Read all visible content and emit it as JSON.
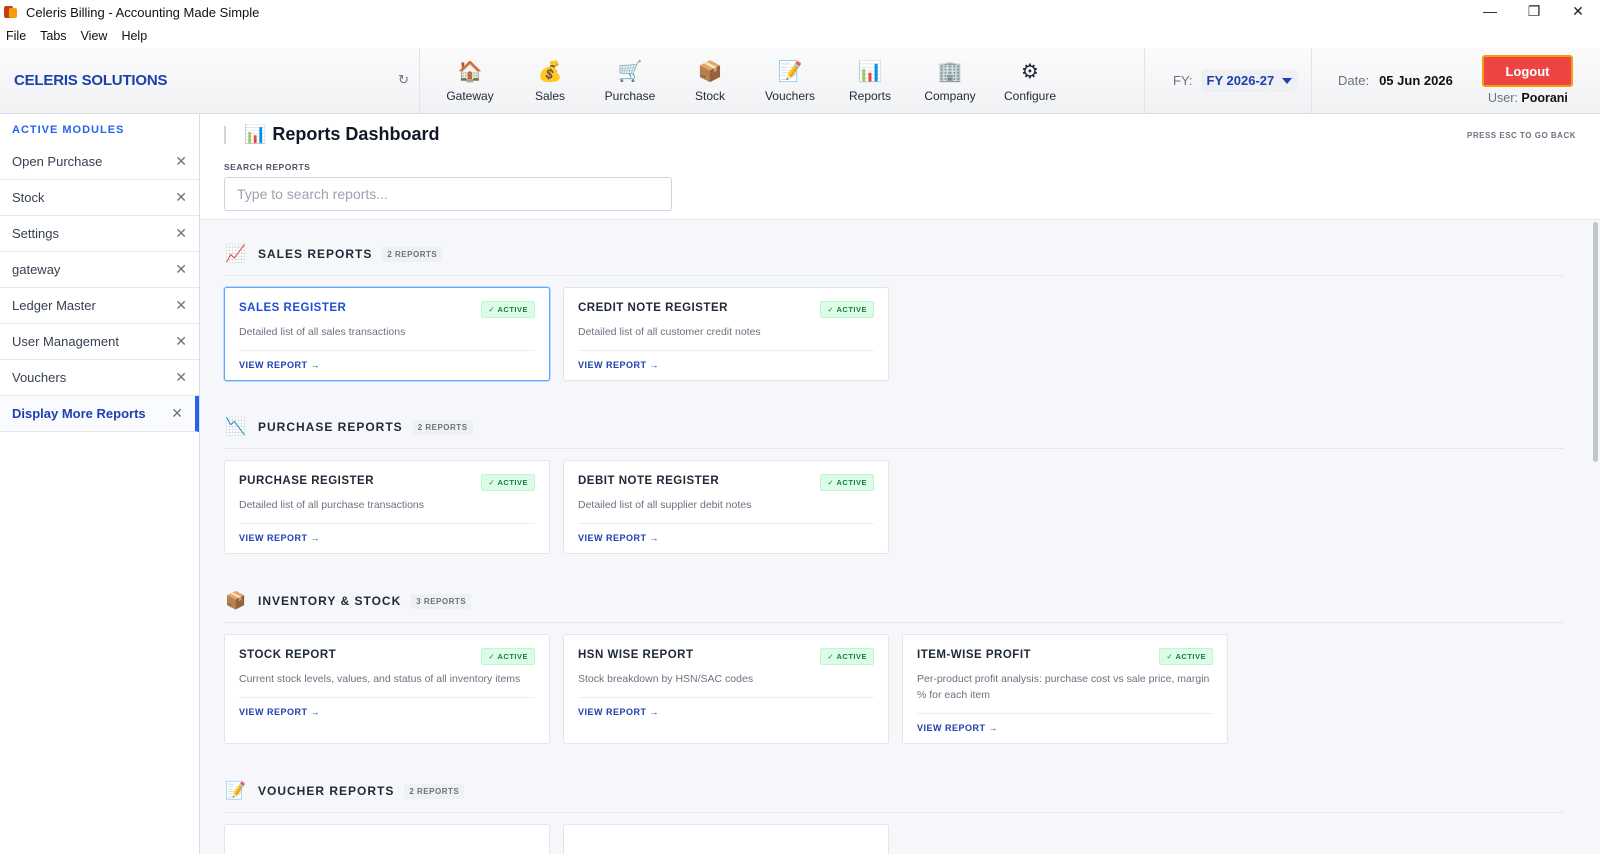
{
  "window": {
    "title": "Celeris Billing - Accounting Made Simple",
    "controls": [
      "—",
      "❐",
      "✕"
    ]
  },
  "menu": [
    "File",
    "Tabs",
    "View",
    "Help"
  ],
  "header": {
    "brand": "CELERIS SOLUTIONS",
    "refresh_icon": "↻",
    "nav": [
      {
        "label": "Gateway",
        "icon": "🏠"
      },
      {
        "label": "Sales",
        "icon": "💰"
      },
      {
        "label": "Purchase",
        "icon": "🛒"
      },
      {
        "label": "Stock",
        "icon": "📦"
      },
      {
        "label": "Vouchers",
        "icon": "📝"
      },
      {
        "label": "Reports",
        "icon": "📊"
      },
      {
        "label": "Company",
        "icon": "🏢"
      },
      {
        "label": "Configure",
        "icon": "⚙"
      }
    ],
    "fy_label": "FY:",
    "fy_value": "FY 2026-27",
    "date_label": "Date:",
    "date_value": "05 Jun 2026",
    "logout_label": "Logout",
    "user_label": "User:",
    "user_value": "Poorani"
  },
  "sidebar": {
    "section_title": "ACTIVE MODULES",
    "close_icon": "✕",
    "items": [
      {
        "label": "Open Purchase"
      },
      {
        "label": "Stock"
      },
      {
        "label": "Settings"
      },
      {
        "label": "gateway"
      },
      {
        "label": "Ledger Master"
      },
      {
        "label": "User Management"
      },
      {
        "label": "Vouchers"
      },
      {
        "label": "Display More Reports"
      }
    ],
    "active_index": 7
  },
  "main": {
    "title_icon": "📊",
    "title": "Reports Dashboard",
    "esc_hint": "PRESS ESC TO GO BACK",
    "search_label": "SEARCH REPORTS",
    "search_placeholder": "Type to search reports...",
    "search_value": "",
    "sections": [
      {
        "title": "SALES REPORTS",
        "count": "2 REPORTS",
        "icon": "📈",
        "cards": [
          {
            "title": "SALES REGISTER",
            "badge": "✓ ACTIVE",
            "desc": "Detailed list of all sales transactions",
            "link": "VIEW REPORT →"
          },
          {
            "title": "CREDIT NOTE REGISTER",
            "badge": "✓ ACTIVE",
            "desc": "Detailed list of all customer credit notes",
            "link": "VIEW REPORT →"
          }
        ]
      },
      {
        "title": "PURCHASE REPORTS",
        "count": "2 REPORTS",
        "icon": "📉",
        "cards": [
          {
            "title": "PURCHASE REGISTER",
            "badge": "✓ ACTIVE",
            "desc": "Detailed list of all purchase transactions",
            "link": "VIEW REPORT →"
          },
          {
            "title": "DEBIT NOTE REGISTER",
            "badge": "✓ ACTIVE",
            "desc": "Detailed list of all supplier debit notes",
            "link": "VIEW REPORT →"
          }
        ]
      },
      {
        "title": "INVENTORY & STOCK",
        "count": "3 REPORTS",
        "icon": "📦",
        "cards": [
          {
            "title": "STOCK REPORT",
            "badge": "✓ ACTIVE",
            "desc": "Current stock levels, values, and status of all inventory items",
            "link": "VIEW REPORT →"
          },
          {
            "title": "HSN WISE REPORT",
            "badge": "✓ ACTIVE",
            "desc": "Stock breakdown by HSN/SAC codes",
            "link": "VIEW REPORT →"
          },
          {
            "title": "ITEM-WISE PROFIT",
            "badge": "✓ ACTIVE",
            "desc": "Per-product profit analysis: purchase cost vs sale price, margin % for each item",
            "link": "VIEW REPORT →"
          }
        ]
      },
      {
        "title": "VOUCHER REPORTS",
        "count": "2 REPORTS",
        "icon": "📝",
        "cards": []
      }
    ]
  },
  "colors": {
    "brand": "#1e40af",
    "logout": "#ef4444",
    "active_badge": "#15803d"
  }
}
